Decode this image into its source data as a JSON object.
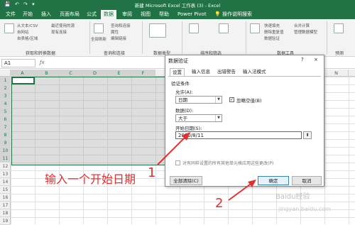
{
  "window": {
    "title": "新建 Microsoft Excel 工作表 (3) - Excel",
    "quick_access": "💾 ↶ ↷ ▾"
  },
  "tabs": [
    "文件",
    "开始",
    "插入",
    "页面布局",
    "公式",
    "数据",
    "审阅",
    "视图",
    "帮助",
    "Power Pivot"
  ],
  "tell_me": "操作说明搜索",
  "ribbon": {
    "group1_items": [
      "从文本/CSV",
      "自网站",
      "自表格/区域",
      "最近使用的源",
      "现有连接"
    ],
    "group1_label": "获取和转换数据",
    "group2_items": [
      "全部刷新",
      "查询和连接",
      "属性",
      "编辑链接"
    ],
    "group2_label": "查询和连接",
    "group3_label": "数据类型",
    "group4_label": "排序和筛选",
    "group5_items": [
      "快速填充",
      "删除重复值",
      "数据验证",
      "合并计算",
      "管理数据模型"
    ],
    "group5_label": "数据工具",
    "group6_label": "预测"
  },
  "namebox": "A1",
  "columns": [
    "A",
    "B",
    "C",
    "D",
    "E",
    "F",
    "G",
    "H",
    "I",
    "J",
    "K",
    "L",
    "M",
    "N"
  ],
  "rows": [
    "1",
    "2",
    "3",
    "4",
    "5",
    "6",
    "7",
    "8",
    "9",
    "10",
    "11",
    "12",
    "13",
    "14",
    "15",
    "16",
    "17",
    "18",
    "19"
  ],
  "dialog": {
    "title": "数据验证",
    "help": "?",
    "close": "×",
    "tabs": [
      "设置",
      "输入信息",
      "出错警告",
      "输入法模式"
    ],
    "section": "验证条件",
    "allow_label": "允许(A):",
    "allow_value": "日期",
    "ignore_blank": "忽略空值(B)",
    "data_label": "数据(D):",
    "data_value": "大于",
    "start_label": "开始日期(S):",
    "start_value": "2000/8/11",
    "apply_all": "对有同样设置的所有其他单元格应用这些更改(P)",
    "clear_all": "全部清除(C)",
    "ok": "确定",
    "cancel": "取消"
  },
  "annotation": {
    "text": "输入一个开始日期",
    "step1": "1",
    "step2": "2"
  },
  "watermark": "Baidu经验",
  "watermark2": "jingyan.baidu.com",
  "colors": {
    "excel_green": "#217346",
    "annotation_red": "#e03030"
  }
}
